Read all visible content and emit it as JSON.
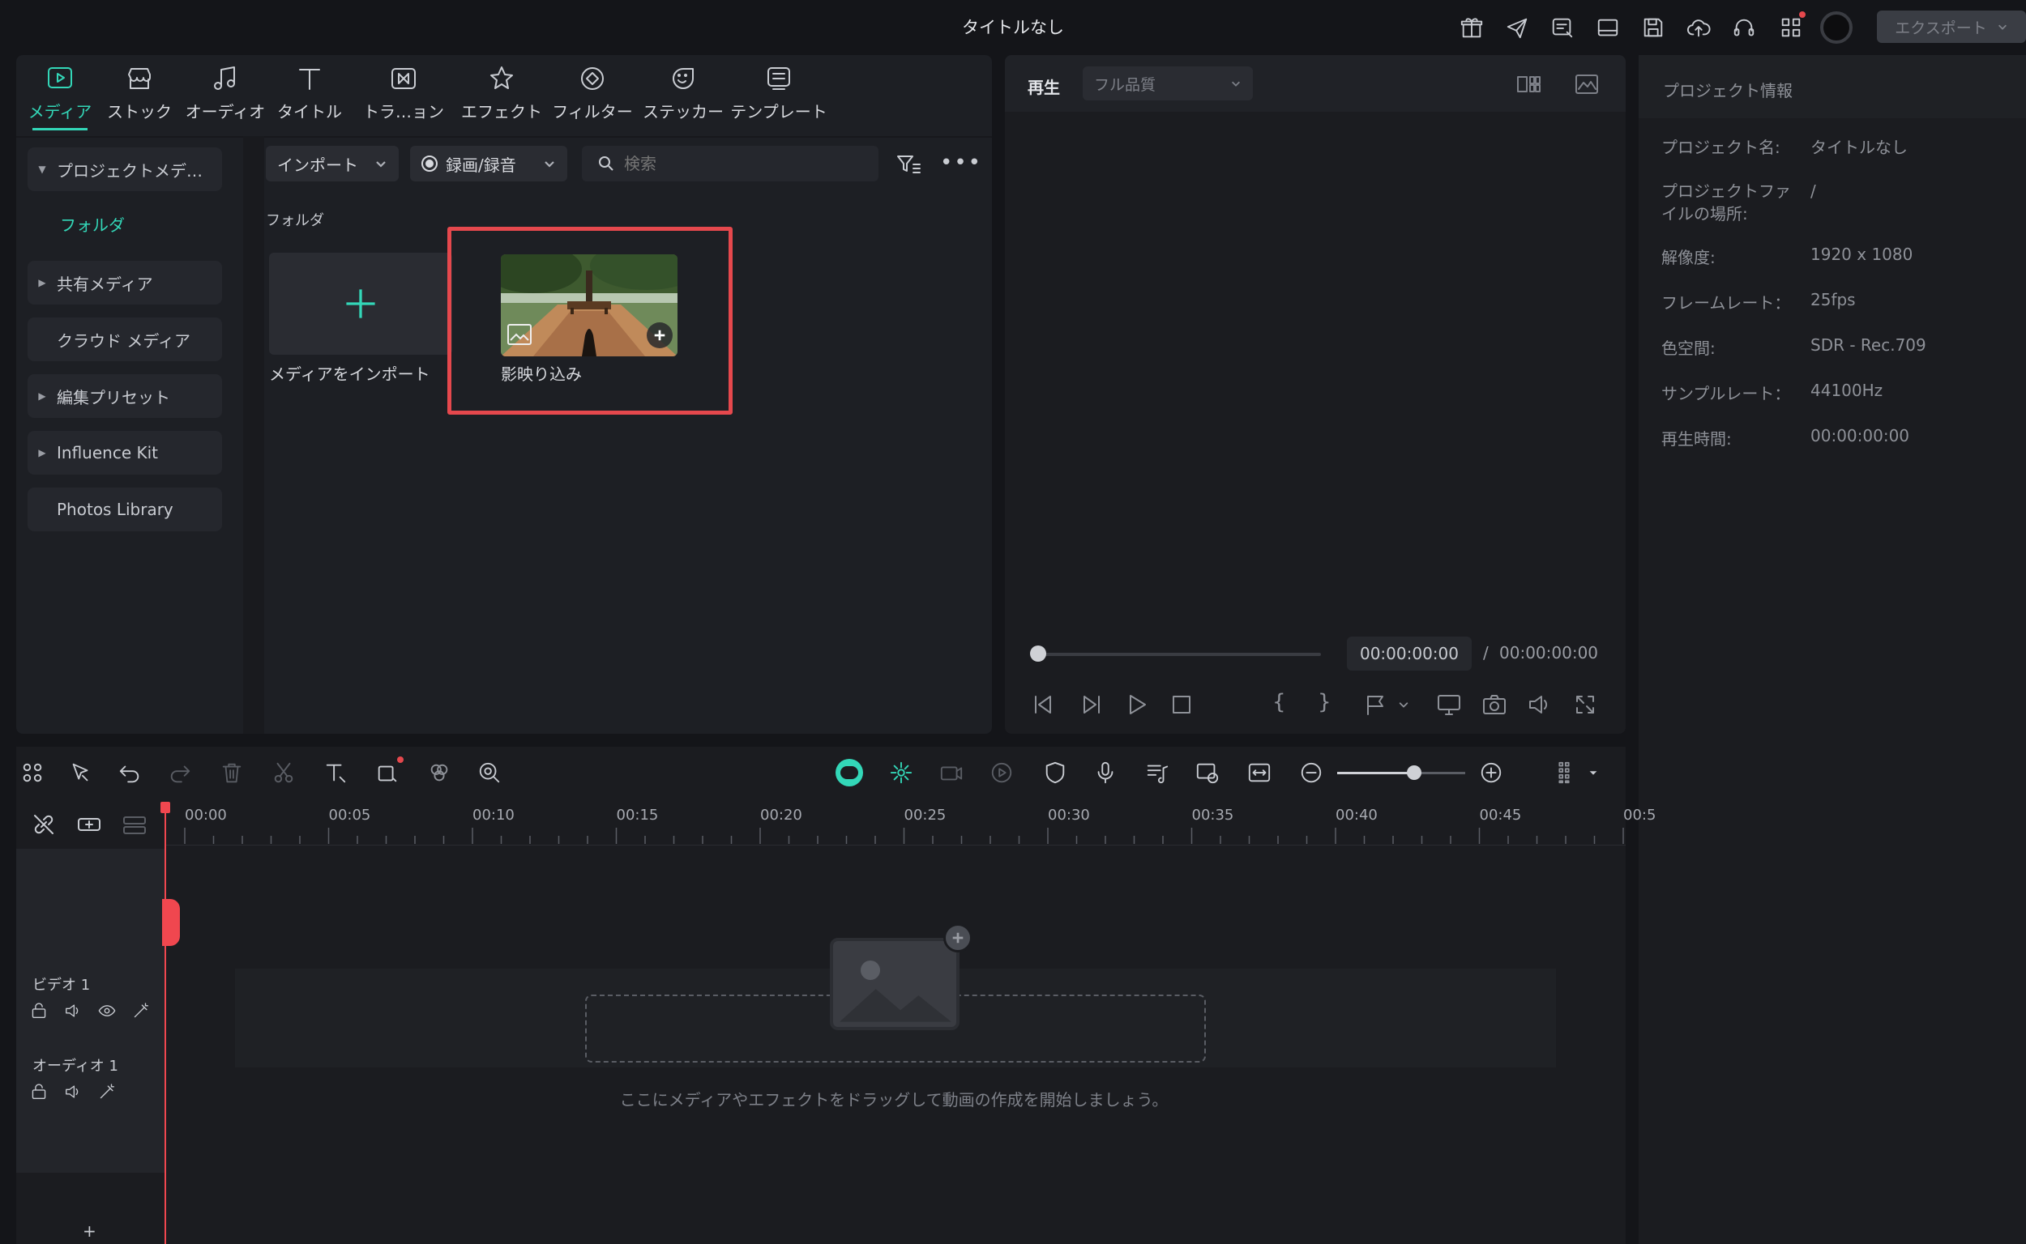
{
  "titlebar": {
    "title": "タイトルなし",
    "export_label": "エクスポート"
  },
  "media_tabs": [
    {
      "label": "メディア",
      "icon": "media-icon",
      "active": true
    },
    {
      "label": "ストック",
      "icon": "stock-icon"
    },
    {
      "label": "オーディオ",
      "icon": "audio-icon"
    },
    {
      "label": "タイトル",
      "icon": "title-icon"
    },
    {
      "label": "トラ…ョン",
      "icon": "transition-icon"
    },
    {
      "label": "エフェクト",
      "icon": "effect-icon"
    },
    {
      "label": "フィルター",
      "icon": "filter-icon"
    },
    {
      "label": "ステッカー",
      "icon": "sticker-icon"
    },
    {
      "label": "テンプレート",
      "icon": "template-icon"
    }
  ],
  "sidebar": {
    "items": [
      {
        "label": "プロジェクトメデ…",
        "expanded": true
      },
      {
        "label": "フォルダ",
        "selected": true
      },
      {
        "label": "共有メディア"
      },
      {
        "label": "クラウド メディア"
      },
      {
        "label": "編集プリセット"
      },
      {
        "label": "Influence Kit"
      },
      {
        "label": "Photos Library"
      }
    ]
  },
  "media_toolbar": {
    "import_label": "インポート",
    "record_label": "録画/録音",
    "search_placeholder": "検索"
  },
  "media_area": {
    "folder_label": "フォルダ",
    "import_tile_label": "メディアをインポート",
    "clip_label": "影映り込み"
  },
  "preview": {
    "tab_label": "再生",
    "quality": "フル品質",
    "current_time": "00:00:00:00",
    "separator": "/",
    "total_time": "00:00:00:00"
  },
  "project_info": {
    "heading": "プロジェクト情報",
    "rows": [
      {
        "label": "プロジェクト名:",
        "value": "タイトルなし"
      },
      {
        "label": "プロジェクトファイルの場所:",
        "value": "/"
      },
      {
        "label": "解像度:",
        "value": "1920 x 1080"
      },
      {
        "label": "フレームレート：",
        "value": "25fps"
      },
      {
        "label": "色空間:",
        "value": "SDR - Rec.709"
      },
      {
        "label": "サンプルレート：",
        "value": "44100Hz"
      },
      {
        "label": "再生時間:",
        "value": "00:00:00:00"
      }
    ]
  },
  "timeline": {
    "ticks": [
      "00:00",
      "00:05",
      "00:10",
      "00:15",
      "00:20",
      "00:25",
      "00:30",
      "00:35",
      "00:40",
      "00:45",
      "00:5"
    ],
    "video_track": "ビデオ 1",
    "audio_track": "オーディオ 1",
    "drop_hint": "ここにメディアやエフェクトをドラッグして動画の作成を開始しましょう。",
    "zoom_level": 0.6
  },
  "colors": {
    "accent": "#33d7b8",
    "highlight": "#e5484d",
    "playhead": "#f0474f"
  }
}
